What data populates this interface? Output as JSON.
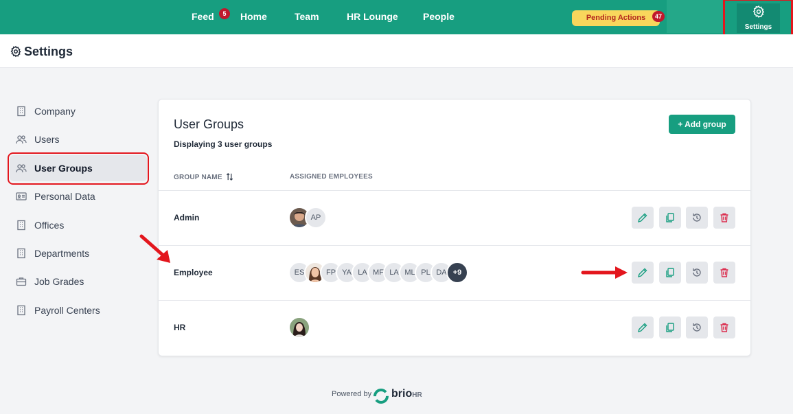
{
  "topnav": {
    "items": [
      {
        "label": "Feed",
        "badge": "5"
      },
      {
        "label": "Home"
      },
      {
        "label": "Team"
      },
      {
        "label": "HR Lounge"
      },
      {
        "label": "People"
      }
    ],
    "pending_label": "Pending Actions",
    "pending_count": "47",
    "settings_label": "Settings"
  },
  "page": {
    "title": "Settings"
  },
  "sidebar": {
    "items": [
      {
        "label": "Company",
        "icon": "building-icon"
      },
      {
        "label": "Users",
        "icon": "users-icon"
      },
      {
        "label": "User Groups",
        "icon": "users-icon",
        "active": true
      },
      {
        "label": "Personal Data",
        "icon": "id-card-icon"
      },
      {
        "label": "Offices",
        "icon": "building-icon"
      },
      {
        "label": "Departments",
        "icon": "building-icon"
      },
      {
        "label": "Job Grades",
        "icon": "briefcase-icon"
      },
      {
        "label": "Payroll Centers",
        "icon": "building-icon"
      }
    ]
  },
  "card": {
    "title": "User Groups",
    "subtitle": "Displaying 3 user groups",
    "add_button": "+ Add group",
    "columns": {
      "name": "GROUP NAME",
      "assigned": "ASSIGNED EMPLOYEES"
    },
    "rows": [
      {
        "name": "Admin",
        "avatars": [
          "photo",
          "AP"
        ]
      },
      {
        "name": "Employee",
        "avatars": [
          "ES",
          "photo",
          "FP",
          "YA",
          "LA",
          "MF",
          "LA",
          "ML",
          "PL",
          "DA",
          "+9"
        ]
      },
      {
        "name": "HR",
        "avatars": [
          "photo"
        ]
      }
    ]
  },
  "footer": {
    "powered_by": "Powered by",
    "brand_main": "brio",
    "brand_suffix": "HR"
  },
  "colors": {
    "brand": "#179e80",
    "badge": "#c0182c",
    "pending_bg": "#f9d65c",
    "highlight": "#e3161d"
  }
}
